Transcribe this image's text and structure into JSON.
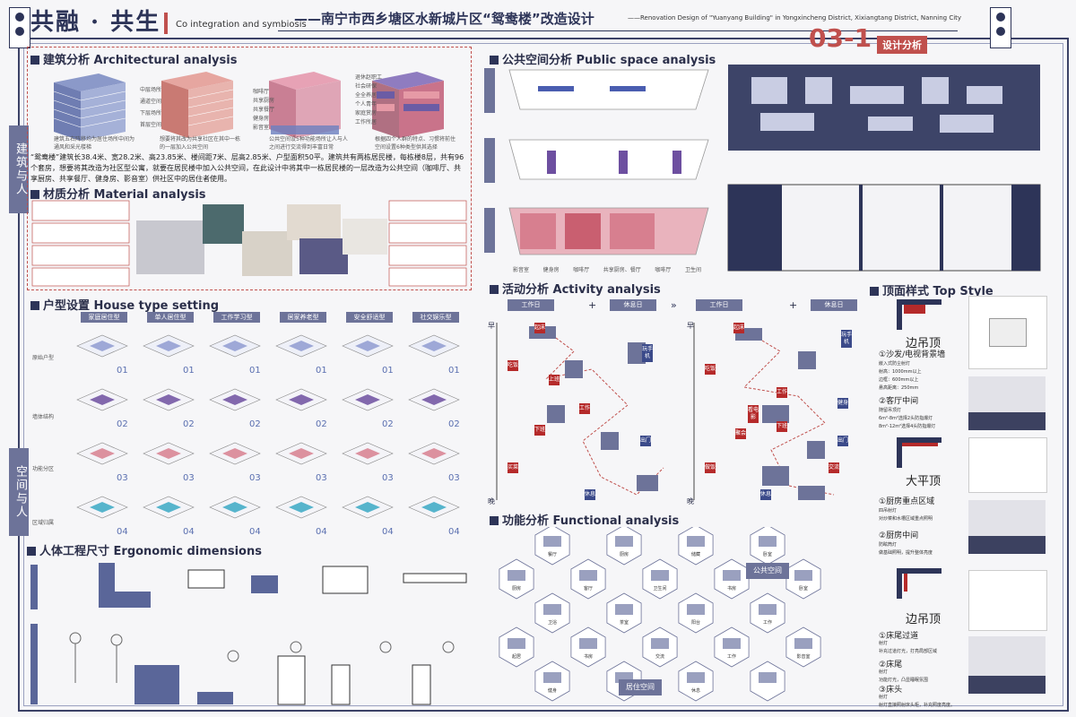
{
  "header": {
    "title_main": "共融 · 共生",
    "title_en": "Co integration and symbiosis",
    "title_zh": "——南宁市西乡塘区水新城片区“鸳鸯楼”改造设计",
    "title_en2": "——Renovation Design of \"Yuanyang Building\" in Yongxincheng District, Xixiangtang District, Nanning City",
    "badge_number": "03-1",
    "badge_label": "设计分析"
  },
  "side_tabs": {
    "top": "建筑与人",
    "bottom": "空间与人"
  },
  "architectural": {
    "title": "建筑分析 Architectural analysis",
    "caption_1": "建筑五右阵移均为居住场所中间为通风和采光楼梯",
    "caption_2": "想要将其改为共享社区在其中一栋的一层加入公共空间",
    "caption_3": "公共空间设5种功能场所让人与人之间进行交流得到丰富日常",
    "caption_4": "根据四个人群的特点、习惯将前住空间设置6种类型供其选择",
    "labels_2": [
      "中层场所",
      "通道空间",
      "下层场所",
      "首层空间"
    ],
    "labels_3": [
      "咖啡厅",
      "共享厨房",
      "共享餐厅",
      "健身房",
      "影音室"
    ],
    "labels_4": [
      "退休赵职工",
      "社会研保",
      "全全养居",
      "个人青年",
      "家庭赏房",
      "工作所居"
    ],
    "paragraph": "“鸳鸯楼”建筑长38.4米、宽28.2米、高23.85米、楼间距7米、层高2.85米、户型面积50平。建筑共有两栋居民楼，每栋楼8层，共有96个套房，想要将其改造为社区型公寓，就要在居民楼中加入公共空间，在此设计中将其中一栋居民楼的一层改造为公共空间（咖啡厅、共享厨房、共享餐厅、健身房、影音室）供社区中的居住者使用。"
  },
  "material": {
    "title": "材质分析 Material analysis"
  },
  "public_space": {
    "title": "公共空间分析 Public space analysis",
    "plan_labels": [
      "影音室",
      "健身房",
      "咖啡厅",
      "共享厨房、餐厅",
      "咖啡厅",
      "卫生间"
    ]
  },
  "house_type": {
    "title": "户型设置 House type setting",
    "columns": [
      "家庭居住型",
      "单人居住型",
      "工作学习型",
      "居家养老型",
      "安全舒适型",
      "社交娱乐型"
    ],
    "row_labels": [
      "原始户型",
      "墙体结构",
      "功能分区",
      "区域归属"
    ],
    "row_numbers": [
      "01",
      "02",
      "03",
      "04"
    ]
  },
  "ergonomic": {
    "title": "人体工程尺寸 Ergonomic dimensions"
  },
  "activity": {
    "title": "活动分析 Activity analysis",
    "workday": "工作日",
    "restday": "休息日",
    "plus": "+",
    "morning": "早",
    "evening": "晚",
    "tags_left": [
      "起床",
      "吃饭",
      "上班",
      "工作",
      "下班",
      "买菜",
      "玩手机",
      "休息",
      "出门"
    ],
    "tags_right": [
      "起床",
      "吃饭",
      "工作",
      "下班",
      "聚会",
      "看电影",
      "做饭",
      "交流",
      "出门",
      "健身",
      "休息",
      "玩手机"
    ]
  },
  "functional": {
    "title": "功能分析 Functional analysis",
    "public": "公共空间",
    "living": "居住空间",
    "hex_labels": [
      "餐厅",
      "厨房",
      "储藏",
      "卧室",
      "厨房",
      "客厅",
      "卫生间",
      "书房",
      "卧室",
      "卫浴",
      "茶室",
      "阳台",
      "工作",
      "起居",
      "书房",
      "交流",
      "工作",
      "影音室",
      "健身",
      "观影",
      "休息"
    ]
  },
  "top_style": {
    "title": "顶面样式 Top Style",
    "type_1": "边吊顶",
    "item_1a": "①沙发/电视背景墙",
    "note_1a": "嵌入式防尘射灯\n射高：1000mm以上\n边框：600mm以上\n悬高距离：250mm",
    "item_1b": "②客厅中间",
    "note_1b": "随留吊顶灯\n6m²-8m²选择2头防指爆灯\n8m²-12m²选择4头防指爆灯",
    "type_2": "大平顶",
    "item_2a": "①厨房重点区域",
    "note_2a": "四吊射灯\n对炒菜和水槽区域重点照明",
    "item_2b": "②厨房中间",
    "note_2b": "防眩筒灯\n做基础照明，提升整体亮度",
    "type_3": "边吊顶",
    "item_3a": "①床尾过道",
    "note_3a": "射灯\n补充过道灯光，打亮局部区域",
    "item_3b": "②床尾",
    "note_3b": "射灯\n功能灯光，凸显睡眠氛围",
    "item_3c": "③床头",
    "note_3c": "射灯\n射灯直接照射床头柜，补充照度亮度。"
  },
  "colors": {
    "navy": "#2d3458",
    "red": "#c0504d",
    "purple": "#6d4fa0",
    "teal": "#3aa8c4",
    "pink": "#d77f8f"
  }
}
